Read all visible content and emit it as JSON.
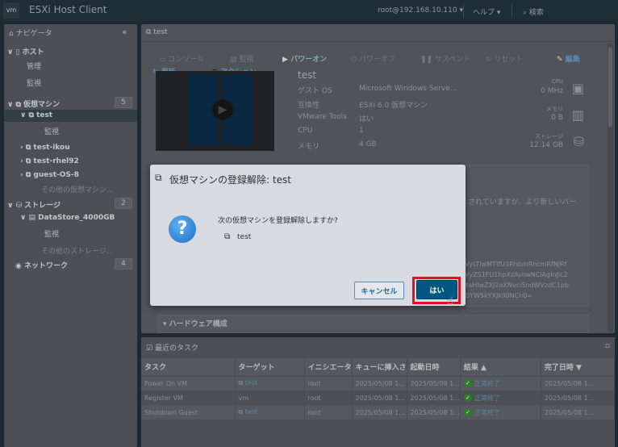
{
  "topbar": {
    "logo": "vm",
    "title": "ESXi Host Client",
    "user": "root@192.168.10.110 ▾",
    "help": "ヘルプ ▾",
    "search": "検索"
  },
  "sidebar": {
    "navigator": "ナビゲータ",
    "collapse": "«",
    "host": "ホスト",
    "host_manage": "管理",
    "host_monitor": "監視",
    "vms": "仮想マシン",
    "vms_count": "5",
    "vm_items": [
      "test",
      "test-ikou",
      "test-rhel92",
      "guest-OS-8"
    ],
    "vm_monitor": "監視",
    "vm_more": "その他の仮想マシン...",
    "storage": "ストレージ",
    "storage_count": "2",
    "datastore": "DataStore_4000GB",
    "ds_monitor": "監視",
    "ds_more": "その他のストレージ...",
    "network": "ネットワーク",
    "network_count": "4"
  },
  "main": {
    "title": "test",
    "toolbar": [
      "コンソール",
      "監視",
      "パワーオン",
      "パワーオフ",
      "サスペンド",
      "リセット",
      "編集",
      "更新",
      "アクション"
    ],
    "vm_name": "test",
    "props": [
      [
        "ゲスト OS",
        "Microsoft Windows Serve..."
      ],
      [
        "互換性",
        "ESXi 6.0 仮想マシン"
      ],
      [
        "VMware Tools",
        "はい"
      ],
      [
        "CPU",
        "1"
      ],
      [
        "メモリ",
        "4 GB"
      ]
    ],
    "stats": [
      [
        "CPU",
        "0 MHz"
      ],
      [
        "メモリ",
        "0 B"
      ],
      [
        "ストレージ",
        "12.14 GB"
      ]
    ],
    "notice": "…されていますが、より新しいバー",
    "encoded": [
      "nVyLTIwMTIfU3RhbmRhcmRfNjRf",
      "5VyZS1FU1hpXzAyliwNCiAgInJlc2",
      "QtaHlwZXJ2aXNvci5ndWVzdC1pb",
      "N0YW5kYXJkIl0NCn0="
    ],
    "hardware": "ハードウェア構成"
  },
  "tasks": {
    "title": "最近のタスク",
    "columns": [
      "タスク",
      "ターゲット",
      "イニシエータ",
      "キューに挿入さ",
      "起動日時",
      "結果 ▲",
      "完了日時 ▼"
    ],
    "rows": [
      [
        "Power On VM",
        "test",
        "root",
        "2025/05/08 1...",
        "2025/05/08 1...",
        "正常終了",
        "2025/05/08 1..."
      ],
      [
        "Register VM",
        "vm",
        "root",
        "2025/05/08 1...",
        "2025/05/08 1...",
        "正常終了",
        "2025/05/08 1..."
      ],
      [
        "Shutdown Guest",
        "test",
        "root",
        "2025/05/08 1...",
        "2025/05/08 1...",
        "正常終了",
        "2025/05/08 1..."
      ]
    ]
  },
  "dialog": {
    "title": "仮想マシンの登録解除: test",
    "message": "次の仮想マシンを登録解除しますか?",
    "vm": "test",
    "cancel": "キャンセル",
    "ok": "はい"
  },
  "colors": {
    "accent": "#005880",
    "highlight": "#e01020",
    "success": "#2f7a25"
  }
}
